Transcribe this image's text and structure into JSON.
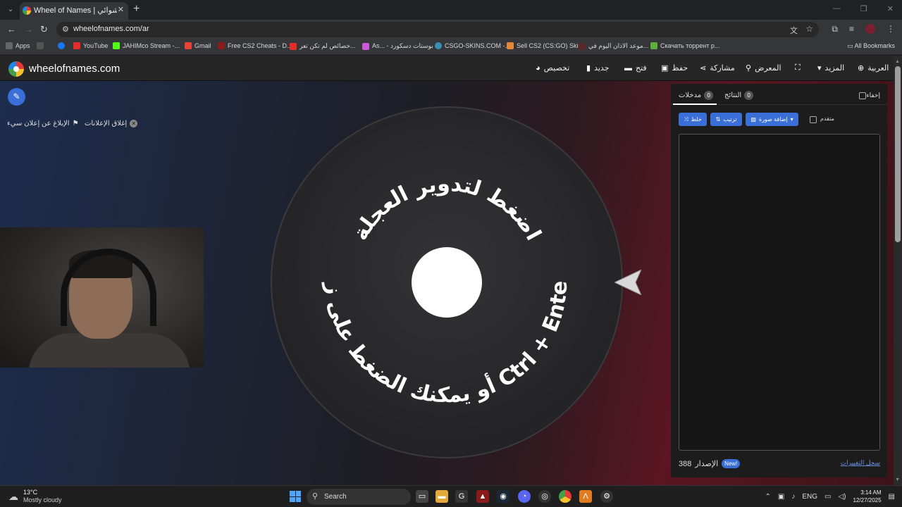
{
  "browser": {
    "tab_title": "Wheel of Names | اسم العشوائي",
    "url": "wheelofnames.com/ar",
    "bookmarks": [
      "Apps",
      "YouTube",
      "JAHIMco Stream -...",
      "Gmail",
      "Free CS2 Cheats - D...",
      "خصائص لم تكن تعر...",
      "As... - بوستات دسكورد",
      "CSGO-SKINS.COM -...",
      "Sell CS2 (CS:GO) Ski...",
      "موعد الاذان اليوم في...",
      "Скачать торрент р..."
    ],
    "all_bookmarks": "All Bookmarks"
  },
  "site": {
    "name": "wheelofnames.com",
    "nav": {
      "language": "العربية",
      "more": "المزيد",
      "gallery": "المعرض",
      "share": "مشاركة",
      "save": "حفظ",
      "open": "فتح",
      "new": "جديد",
      "customize": "تخصيص"
    }
  },
  "ads": {
    "report": "الإبلاغ عن إعلان سيء",
    "close": "إغلاق الإعلانات"
  },
  "wheel": {
    "top_text": "اضغط لتدوير العجلة",
    "bottom_text": "أو يمكنك الضغط على زر Ctrl + Enter",
    "colors": {
      "disc": "#2b2b2d",
      "center": "#ffffff",
      "text": "#ffffff"
    }
  },
  "panel": {
    "tab_entries": "مدخلات",
    "tab_entries_count": "0",
    "tab_results": "النتائج",
    "tab_results_count": "0",
    "hide": "إخفاء",
    "shuffle": "خلط",
    "sort": "ترتيب",
    "add_image": "إضافة صورة",
    "advanced": "متقدم",
    "version_label": "الإصدار",
    "version_number": "388",
    "new_badge": "New!",
    "changelog": "سجل التغييرات"
  },
  "taskbar": {
    "temp": "13°C",
    "weather": "Mostly cloudy",
    "search": "Search",
    "lang": "ENG",
    "time": "3:14 AM",
    "date": "12/27/2025"
  },
  "colors": {
    "accent": "#3a6fd8",
    "bg_left": "#1d2d4e",
    "bg_right": "#5a1622"
  }
}
